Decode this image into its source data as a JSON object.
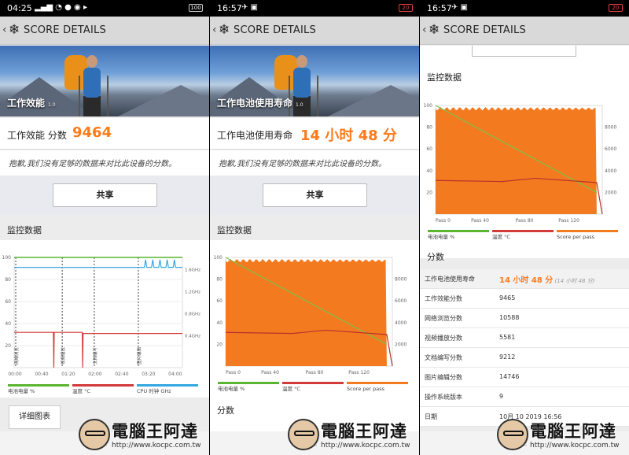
{
  "colors": {
    "accent": "#ff7a1a",
    "battery": "#5cb531",
    "temperature": "#d33b3b",
    "cpu": "#35a8e0",
    "score": "#f47a20"
  },
  "panels": [
    {
      "status": {
        "time": "04:25",
        "battery": "100"
      },
      "header": {
        "title": "SCORE DETAILS"
      },
      "banner": {
        "title": "工作效能",
        "version": "1.0"
      },
      "score": {
        "label": "工作效能 分数",
        "value": "9464"
      },
      "note": "抱歉,我们没有足够的数据来对比此设备的分数。",
      "share_label": "共享",
      "monitor_title": "监控数据",
      "detail_label": "详细图表"
    },
    {
      "status": {
        "time": "16:57",
        "battery": "20"
      },
      "header": {
        "title": "SCORE DETAILS"
      },
      "banner": {
        "title": "工作电池使用寿命",
        "version": "1.0"
      },
      "score": {
        "label": "工作电池使用寿命",
        "value": "14 小时 48 分"
      },
      "note": "抱歉,我们没有足够的数据来对比此设备的分数。",
      "share_label": "共享",
      "monitor_title": "监控数据",
      "section_title": "分数"
    },
    {
      "status": {
        "time": "16:57",
        "battery": "20"
      },
      "header": {
        "title": "SCORE DETAILS"
      },
      "monitor_title": "监控数据",
      "section_title": "分数",
      "table": [
        {
          "key": "工作电池使用寿命",
          "value": "14 小时 48 分",
          "sub": "(14 小时 48 分)"
        },
        {
          "key": "工作效能分数",
          "value": "9465"
        },
        {
          "key": "网络浏览分数",
          "value": "10588"
        },
        {
          "key": "视频播放分数",
          "value": "5581"
        },
        {
          "key": "文档编写分数",
          "value": "9212"
        },
        {
          "key": "图片编辑分数",
          "value": "14746"
        },
        {
          "key": "操作系统版本",
          "value": "9"
        },
        {
          "key": "日期",
          "value": "10月 10 2019 16:56"
        }
      ]
    }
  ],
  "chart_data": [
    {
      "type": "line",
      "x_tick_labels": [
        "00:00",
        "00:40",
        "01:20",
        "02:00",
        "02:40",
        "03:20",
        "04:00"
      ],
      "y_left_ticks": [
        "20",
        "40",
        "60",
        "80",
        "100"
      ],
      "y_right_ticks": [
        "0.4GHz",
        "0.8GHz",
        "1.2GHz",
        "1.6GHz"
      ],
      "annotations": [
        "网络浏览",
        "视频播放",
        "文档编写",
        "图片编辑"
      ],
      "legend": [
        "电池电量 %",
        "温度 °C",
        "CPU 时钟 GHz"
      ],
      "ylim": [
        0,
        100
      ],
      "series": [
        {
          "name": "电池电量 %",
          "x": [
            0,
            4.2
          ],
          "values": [
            100,
            100
          ]
        },
        {
          "name": "温度 °C",
          "x": [
            0,
            4.2
          ],
          "values": [
            32,
            31
          ]
        },
        {
          "name": "CPU 时钟 GHz",
          "x": [
            0,
            3.3,
            4.2
          ],
          "values": [
            1.75,
            1.75,
            1.85
          ]
        }
      ]
    },
    {
      "type": "area",
      "x_tick_labels": [
        "Pass 0",
        "Pass 40",
        "Pass 80",
        "Pass 120"
      ],
      "y_left_ticks": [
        "20",
        "40",
        "60",
        "80",
        "100"
      ],
      "y_right_ticks": [
        "2000",
        "4000",
        "6000",
        "8000"
      ],
      "legend": [
        "电池电量 %",
        "温度 °C",
        "Score per pass"
      ],
      "xlim": [
        0,
        150
      ],
      "ylim": [
        0,
        100
      ],
      "series": [
        {
          "name": "电池电量 %",
          "x": [
            0,
            145
          ],
          "values": [
            100,
            20
          ]
        },
        {
          "name": "温度 °C",
          "x": [
            0,
            60,
            90,
            145,
            150
          ],
          "values": [
            31,
            30,
            33,
            29,
            0
          ]
        },
        {
          "name": "Score per pass",
          "x": [
            0,
            145
          ],
          "values": [
            9500,
            9500
          ]
        }
      ]
    },
    {
      "type": "area",
      "x_tick_labels": [
        "Pass 0",
        "Pass 40",
        "Pass 80",
        "Pass 120"
      ],
      "y_left_ticks": [
        "20",
        "40",
        "60",
        "80",
        "100"
      ],
      "y_right_ticks": [
        "2000",
        "4000",
        "6000",
        "8000"
      ],
      "legend": [
        "电池电量 %",
        "温度 °C",
        "Score per pass"
      ],
      "xlim": [
        0,
        150
      ],
      "ylim": [
        0,
        100
      ],
      "series": [
        {
          "name": "电池电量 %",
          "x": [
            0,
            145
          ],
          "values": [
            100,
            20
          ]
        },
        {
          "name": "温度 °C",
          "x": [
            0,
            60,
            90,
            145,
            150
          ],
          "values": [
            31,
            30,
            33,
            29,
            0
          ]
        },
        {
          "name": "Score per pass",
          "x": [
            0,
            145
          ],
          "values": [
            9500,
            9500
          ]
        }
      ]
    }
  ],
  "watermark": {
    "text": "電腦王阿達",
    "url": "http://www.kocpc.com.tw"
  }
}
